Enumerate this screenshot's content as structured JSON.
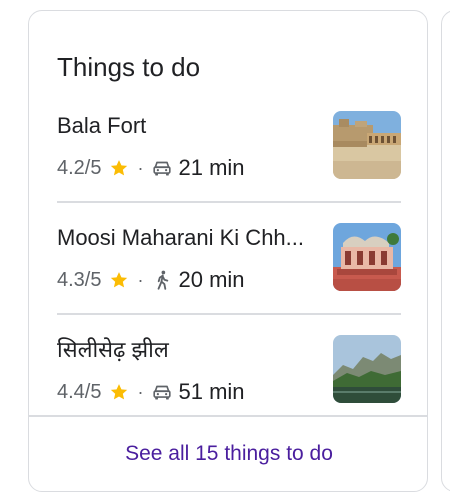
{
  "card": {
    "title": "Things to do",
    "items": [
      {
        "name": "Bala Fort",
        "rating": "4.2/5",
        "separator": "·",
        "travel_mode_icon": "car-icon",
        "duration": "21 min",
        "thumbnail": "fort-photo"
      },
      {
        "name": "Moosi Maharani Ki Chh...",
        "rating": "4.3/5",
        "separator": "·",
        "travel_mode_icon": "walk-icon",
        "duration": "20 min",
        "thumbnail": "cenotaph-photo"
      },
      {
        "name": "सिलीसेढ़ झील",
        "rating": "4.4/5",
        "separator": "·",
        "travel_mode_icon": "car-icon",
        "duration": "51 min",
        "thumbnail": "lake-photo"
      }
    ],
    "see_all": "See all 15 things to do"
  },
  "colors": {
    "text_primary": "#202124",
    "text_secondary": "#5f6368",
    "star": "#fbbc04",
    "link": "#4a1e9e",
    "border": "#dadce0"
  }
}
